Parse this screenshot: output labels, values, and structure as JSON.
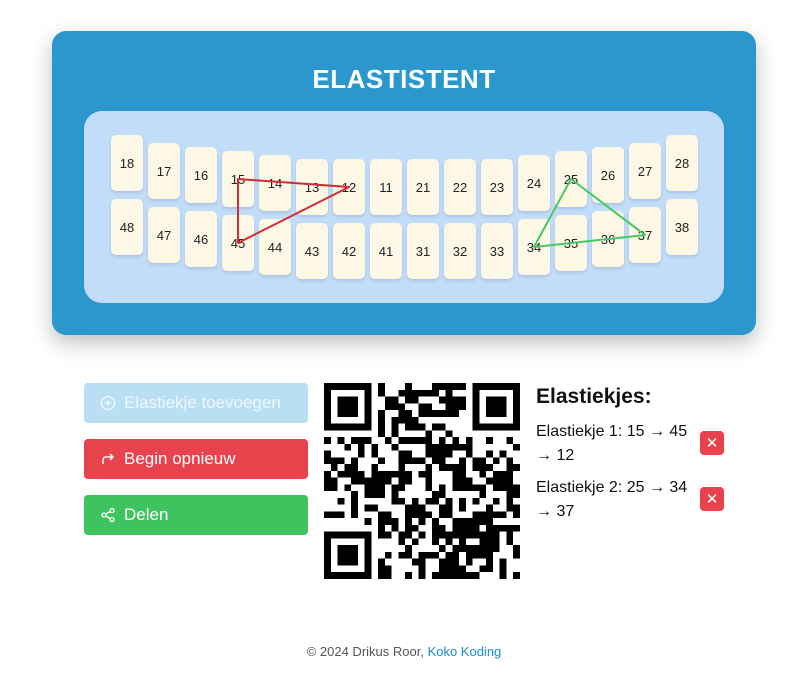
{
  "app": {
    "title": "ELASTISTENT"
  },
  "teeth": {
    "upper": [
      "18",
      "17",
      "16",
      "15",
      "14",
      "13",
      "12",
      "11",
      "21",
      "22",
      "23",
      "24",
      "25",
      "26",
      "27",
      "28"
    ],
    "lower": [
      "48",
      "47",
      "46",
      "45",
      "44",
      "43",
      "42",
      "41",
      "31",
      "32",
      "33",
      "34",
      "35",
      "36",
      "37",
      "38"
    ]
  },
  "bands_drawn": [
    {
      "teeth": [
        "15",
        "45",
        "12"
      ],
      "color": "#d02d35"
    },
    {
      "teeth": [
        "25",
        "34",
        "37"
      ],
      "color": "#46c866"
    }
  ],
  "actions": {
    "add_label": "Elastiekje toevoegen",
    "reset_label": "Begin opnieuw",
    "share_label": "Delen"
  },
  "band_list": {
    "heading": "Elastiekjes:",
    "items": [
      {
        "label": "Elastiekje 1: 15 → 45 → 12",
        "delete": "✕"
      },
      {
        "label": "Elastiekje 2: 25 → 34 → 37",
        "delete": "✕"
      }
    ]
  },
  "footer": {
    "copyright": "© 2024 Drikus Roor, ",
    "link": "Koko Koding"
  },
  "colors": {
    "header": "#2c97cc",
    "mouth": "#c2ddfa",
    "danger": "#e8434d",
    "success": "#3ec35f",
    "band_red": "#d02d35",
    "band_green": "#46c866"
  }
}
